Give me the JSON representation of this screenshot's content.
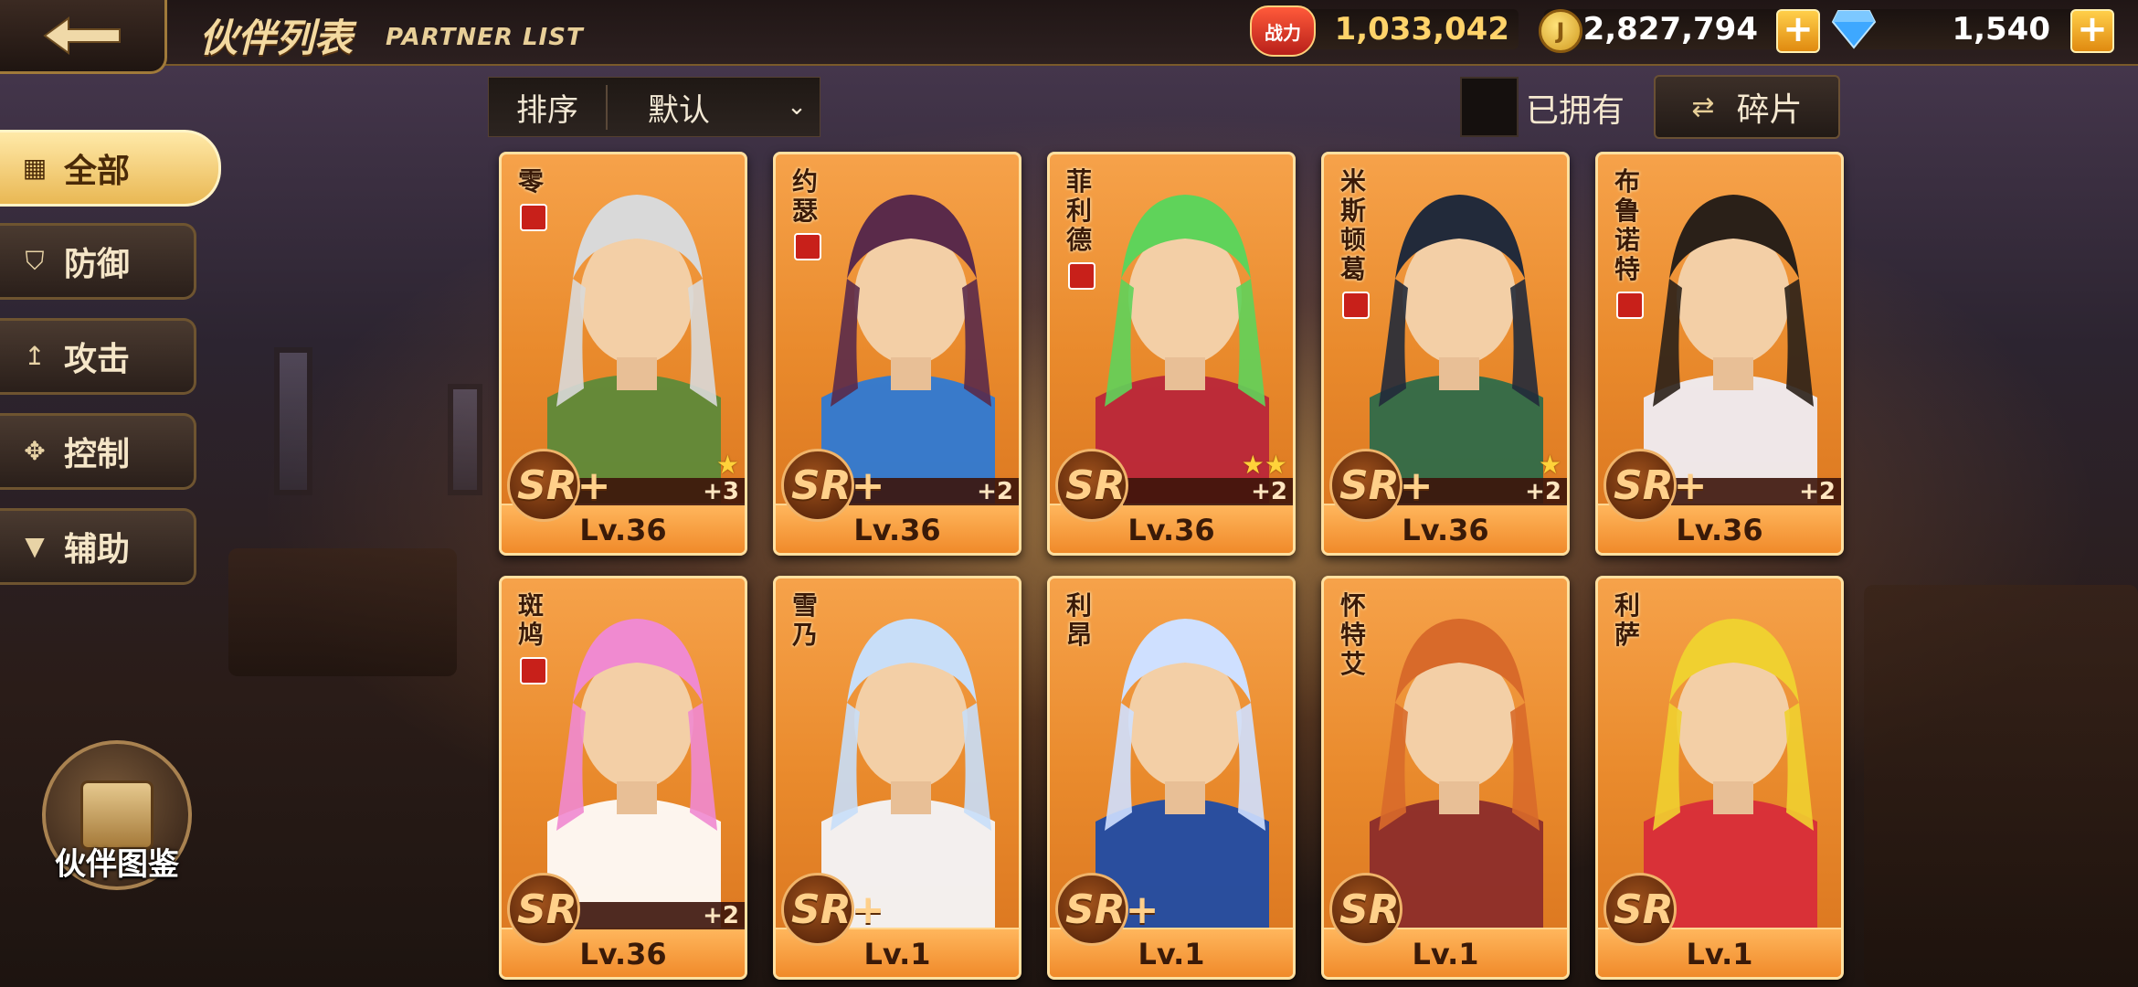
{
  "header": {
    "title": "伙伴列表",
    "subtitle": "PARTNER LIST",
    "power_icon_label": "战力",
    "power_value": "1,033,042",
    "gold_value": "2,827,794",
    "gem_value": "1,540",
    "plus_symbol": "+"
  },
  "sidebar": {
    "items": [
      {
        "label": "全部",
        "icon": "grid-icon",
        "active": true
      },
      {
        "label": "防御",
        "icon": "shield-icon"
      },
      {
        "label": "攻击",
        "icon": "sword-icon"
      },
      {
        "label": "控制",
        "icon": "control-icon"
      },
      {
        "label": "辅助",
        "icon": "support-icon"
      }
    ],
    "catalog_label": "伙伴图鉴"
  },
  "filter": {
    "sort_label": "排序",
    "sort_value": "默认",
    "owned_label": "已拥有",
    "fragment_label": "碎片"
  },
  "partners": [
    {
      "name": "零",
      "rarity": "SR+",
      "level": "Lv.36",
      "plus": "+3",
      "stars": "★",
      "role": true
    },
    {
      "name": "约瑟",
      "rarity": "SR+",
      "level": "Lv.36",
      "plus": "+2",
      "stars": "",
      "role": true
    },
    {
      "name": "菲利德",
      "rarity": "SR",
      "level": "Lv.36",
      "plus": "+2",
      "stars": "★★",
      "role": true
    },
    {
      "name": "米斯顿葛",
      "rarity": "SR+",
      "level": "Lv.36",
      "plus": "+2",
      "stars": "★",
      "role": true
    },
    {
      "name": "布鲁诺特",
      "rarity": "SR+",
      "level": "Lv.36",
      "plus": "+2",
      "stars": "",
      "role": true
    },
    {
      "name": "斑鸠",
      "rarity": "SR",
      "level": "Lv.36",
      "plus": "+2",
      "stars": "",
      "role": true
    },
    {
      "name": "雪乃",
      "rarity": "SR+",
      "level": "Lv.1",
      "plus": "",
      "stars": "",
      "role": false
    },
    {
      "name": "利昂",
      "rarity": "SR+",
      "level": "Lv.1",
      "plus": "",
      "stars": "",
      "role": false
    },
    {
      "name": "怀特艾",
      "rarity": "SR",
      "level": "Lv.1",
      "plus": "",
      "stars": "",
      "role": false
    },
    {
      "name": "利萨",
      "rarity": "SR",
      "level": "Lv.1",
      "plus": "",
      "stars": "",
      "role": false
    }
  ],
  "colors": {
    "card_orange": "#e98a2c",
    "accent_gold": "#ffcf4a",
    "power_red": "#c8201a"
  }
}
